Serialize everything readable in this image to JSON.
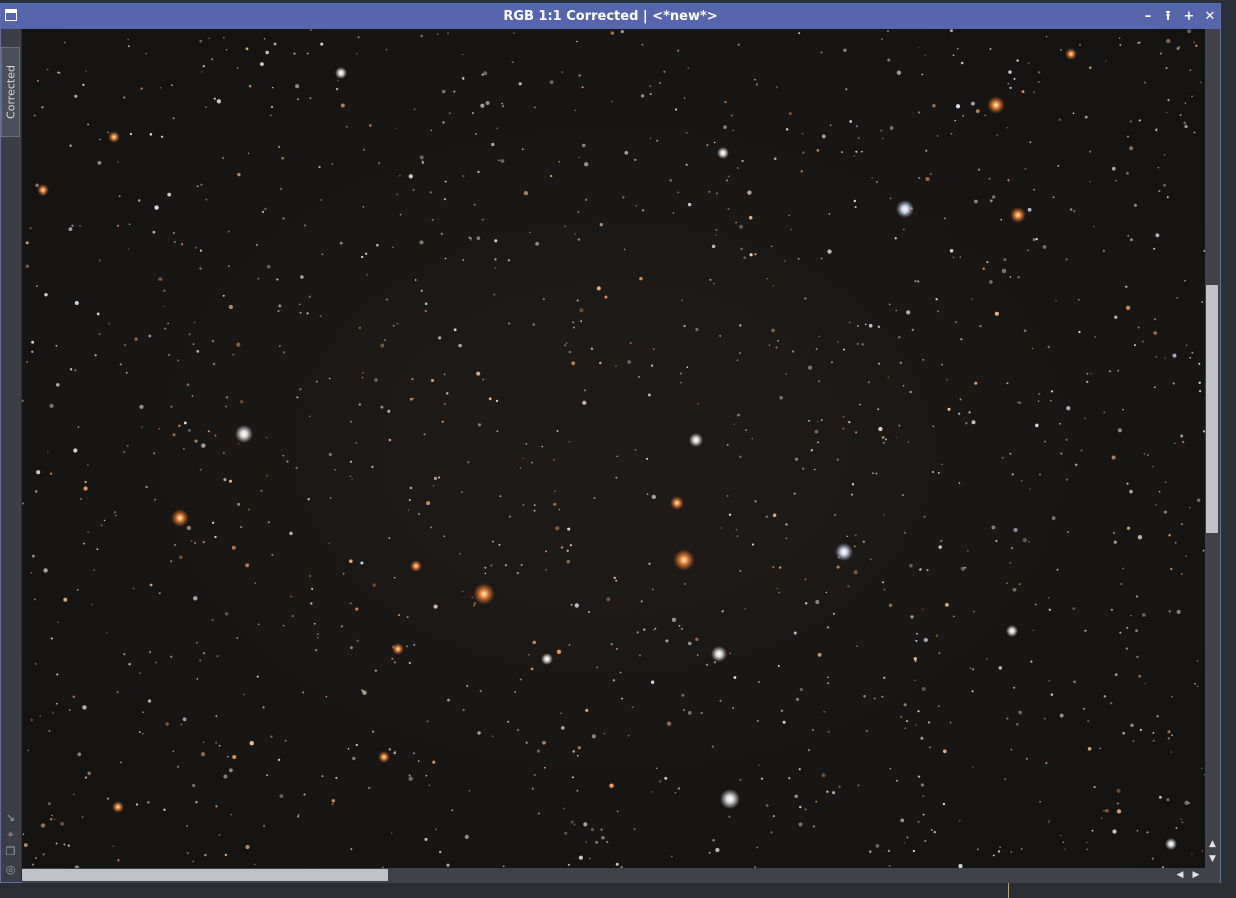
{
  "window": {
    "title": "RGB 1:1 Corrected | <*new*>",
    "controls": {
      "minimize": "–",
      "shade": "⭱",
      "maximize": "+",
      "close": "✕"
    }
  },
  "left_strip": {
    "tab_label": "Corrected",
    "tools": [
      "arrow-icon",
      "crosshair-icon",
      "window-icon",
      "target-icon"
    ]
  },
  "scrollbars": {
    "vertical_position": 0.32,
    "vertical_visible_fraction": 0.31,
    "horizontal_position": 0.0,
    "horizontal_visible_fraction": 0.32
  },
  "colors": {
    "titlebar": "#5566ad",
    "window_border": "#5a6fb8",
    "sky": "#181614",
    "star_white": "#f2f2f5",
    "star_orange": "#ff8a3a",
    "star_blue": "#dfe8ff"
  }
}
